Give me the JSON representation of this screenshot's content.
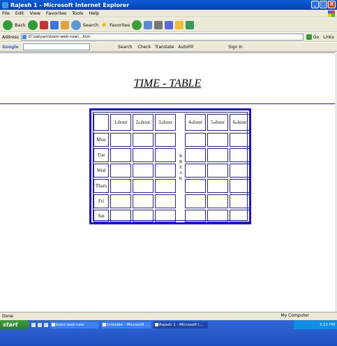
{
  "window": {
    "title": "Rajesh 1 - Microsoft Internet Explorer",
    "min": "_",
    "max": "□",
    "close": "X"
  },
  "menu": [
    "File",
    "Edit",
    "View",
    "Favorites",
    "Tools",
    "Help"
  ],
  "toolbar": {
    "back": "Back",
    "search": "Search",
    "favorites": "Favorites"
  },
  "address": {
    "label": "Address",
    "value": "D:\\satyam\\bomi-web-new\\...htm",
    "go": "Go",
    "links": "Links"
  },
  "google": {
    "logo": "Google",
    "search": "Search",
    "check": "Check",
    "translate": "Translate",
    "autofill": "AutoFill",
    "sign_in": "Sign In"
  },
  "page": {
    "title": "TIME - TABLE"
  },
  "timetable": {
    "hours": [
      {
        "n": "1",
        "sup": "st",
        "t": "hour"
      },
      {
        "n": "2",
        "sup": "nd",
        "t": "hour"
      },
      {
        "n": "3",
        "sup": "rd",
        "t": "hour"
      },
      {
        "n": "4",
        "sup": "th",
        "t": "hour"
      },
      {
        "n": "5",
        "sup": "th",
        "t": "hour"
      },
      {
        "n": "6",
        "sup": "th",
        "t": "hour"
      }
    ],
    "days": [
      "Mon",
      "Tue",
      "Wed",
      "Thurs",
      "Fri",
      "Sat"
    ],
    "break_letters": [
      "B",
      "R",
      "E",
      "A",
      "K"
    ]
  },
  "status": {
    "text": "Done",
    "zone": "My Computer"
  },
  "taskbar": {
    "start": "start",
    "items": [
      "bomi-web-new",
      "timtable - Microsoft ...",
      "Rajesh 1 - Microsoft I..."
    ],
    "clock": "3:22 PM"
  }
}
